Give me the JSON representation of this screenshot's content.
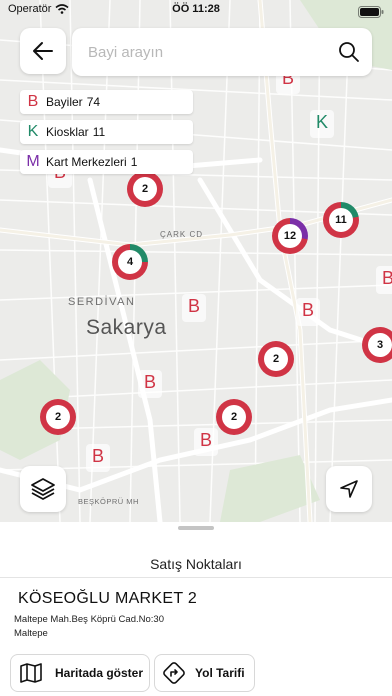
{
  "status_bar": {
    "carrier": "Operatör",
    "time": "ÖÖ 11:28"
  },
  "search": {
    "placeholder": "Bayi arayın"
  },
  "legend": [
    {
      "letter": "B",
      "label": "Bayiler",
      "count": "74",
      "color": "#d03445"
    },
    {
      "letter": "K",
      "label": "Kiosklar",
      "count": "11",
      "color": "#218a68"
    },
    {
      "letter": "M",
      "label": "Kart Merkezleri",
      "count": "1",
      "color": "#7b2fa8"
    }
  ],
  "map": {
    "city_label": "Sakarya",
    "district_label": "SERDİVAN",
    "street_label": "ÇARK CD",
    "neighborhood_label": "BEŞKÖPRÜ MH",
    "clusters": [
      "2",
      "4",
      "12",
      "11",
      "2",
      "3",
      "2",
      "2"
    ],
    "b_markers": [
      "B",
      "B",
      "B",
      "B",
      "B",
      "B",
      "B",
      "B"
    ],
    "k_markers": [
      "K"
    ]
  },
  "sheet": {
    "title": "Satış Noktaları",
    "store_name": "KÖSEOĞLU MARKET 2",
    "store_address": "Maltepe Mah.Beş Köprü Cad.No:30",
    "store_district": "Maltepe",
    "show_on_map_label": "Haritada göster",
    "directions_label": "Yol Tarifi"
  },
  "colors": {
    "bayi": "#d03445",
    "kiosk": "#218a68",
    "kart_merkezi": "#7b2fa8"
  },
  "icons": {
    "back": "arrow-left-icon",
    "search": "magnifier-icon",
    "layers": "layers-icon",
    "location": "navigation-arrow-icon",
    "map": "folded-map-icon",
    "directions": "turn-right-sign-icon"
  }
}
